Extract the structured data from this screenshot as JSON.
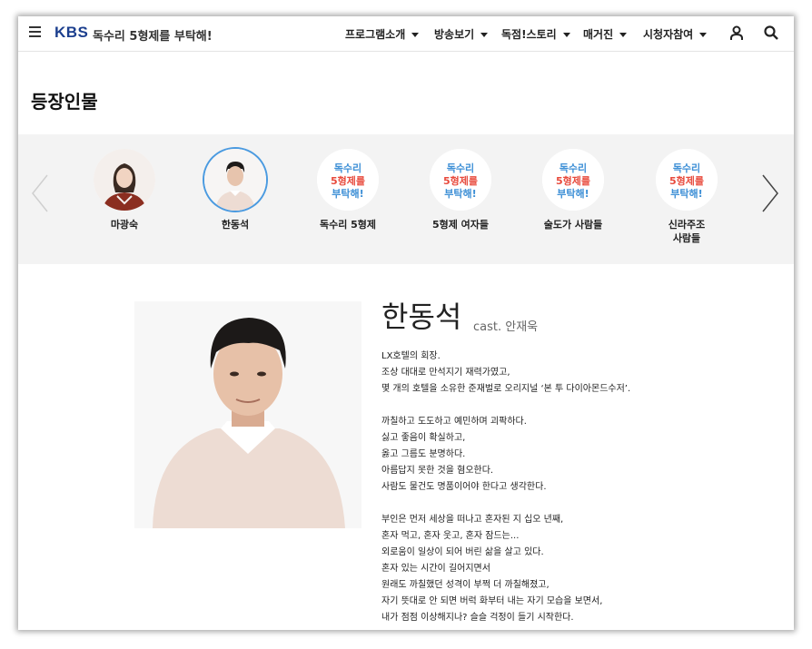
{
  "header": {
    "logo": "KBS",
    "title": "독수리 5형제를 부탁해!",
    "nav": [
      {
        "label": "프로그램소개"
      },
      {
        "label": "방송보기"
      },
      {
        "label": "독점!스토리"
      },
      {
        "label": "매거진"
      },
      {
        "label": "시청자참여"
      }
    ]
  },
  "page": {
    "title": "등장인물"
  },
  "characters": [
    {
      "name": "마광숙"
    },
    {
      "name": "한동석",
      "selected": true
    },
    {
      "name": "독수리 5형제"
    },
    {
      "name": "5형제 여자들"
    },
    {
      "name": "술도가 사람들"
    },
    {
      "name": "신라주조 사람들",
      "line1": "신라주조",
      "line2": "사람들"
    }
  ],
  "logo_text": {
    "line1": "독수리",
    "line2": "5형제를",
    "line3": "부탁해!"
  },
  "detail": {
    "name": "한동석",
    "cast": "cast. 안재욱",
    "bio": [
      [
        "LX호텔의 회장.",
        "조상 대대로 만석지기 재력가였고,",
        "몇 개의 호텔을 소유한 준재벌로 오리지널 ‘본 투 다이아몬드수저’."
      ],
      [
        "까칠하고 도도하고 예민하며 괴팍하다.",
        "싫고 좋음이 확실하고,",
        "옳고 그름도 분명하다.",
        "아름답지 못한 것을 혐오한다.",
        "사람도 물건도 명품이어야 한다고 생각한다."
      ],
      [
        "부인은 먼저 세상을 떠나고 혼자된 지 십오 년째,",
        "혼자 먹고, 혼자 웃고, 혼자 잠드는...",
        "외로움이 일상이 되어 버린 삶을 살고 있다.",
        "혼자 있는 시간이 길어지면서",
        "원래도 까칠했던 성격이 부쩍 더 까칠해졌고,",
        "자기 뜻대로 안 되면 버럭 화부터 내는 자기 모습을 보면서,",
        "내가 점점 이상해지나? 슬슬 걱정이 들기 시작한다."
      ]
    ]
  },
  "colors": {
    "brand": "#1c3f8e",
    "selected_ring": "#4a9ae0",
    "logo_blue": "#3d8fd6",
    "logo_red": "#e84a3c"
  }
}
